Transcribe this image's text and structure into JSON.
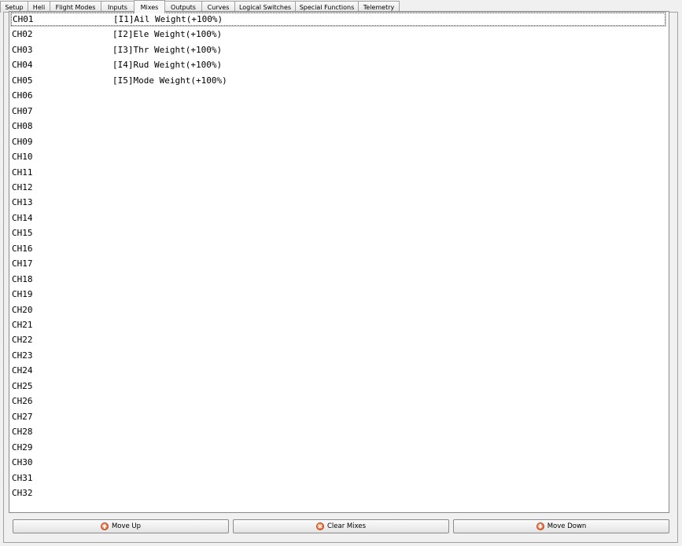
{
  "tabs": [
    {
      "label": "Setup",
      "active": false
    },
    {
      "label": "Heli",
      "active": false
    },
    {
      "label": "Flight Modes",
      "active": false
    },
    {
      "label": "Inputs",
      "active": false
    },
    {
      "label": "Mixes",
      "active": true
    },
    {
      "label": "Outputs",
      "active": false
    },
    {
      "label": "Curves",
      "active": false
    },
    {
      "label": "Logical Switches",
      "active": false
    },
    {
      "label": "Special Functions",
      "active": false
    },
    {
      "label": "Telemetry",
      "active": false
    }
  ],
  "mixes": [
    {
      "channel": "CH01",
      "mix": "[I1]Ail Weight(+100%)"
    },
    {
      "channel": "CH02",
      "mix": "[I2]Ele Weight(+100%)"
    },
    {
      "channel": "CH03",
      "mix": "[I3]Thr Weight(+100%)"
    },
    {
      "channel": "CH04",
      "mix": "[I4]Rud Weight(+100%)"
    },
    {
      "channel": "CH05",
      "mix": "[I5]Mode Weight(+100%)"
    },
    {
      "channel": "CH06",
      "mix": ""
    },
    {
      "channel": "CH07",
      "mix": ""
    },
    {
      "channel": "CH08",
      "mix": ""
    },
    {
      "channel": "CH09",
      "mix": ""
    },
    {
      "channel": "CH10",
      "mix": ""
    },
    {
      "channel": "CH11",
      "mix": ""
    },
    {
      "channel": "CH12",
      "mix": ""
    },
    {
      "channel": "CH13",
      "mix": ""
    },
    {
      "channel": "CH14",
      "mix": ""
    },
    {
      "channel": "CH15",
      "mix": ""
    },
    {
      "channel": "CH16",
      "mix": ""
    },
    {
      "channel": "CH17",
      "mix": ""
    },
    {
      "channel": "CH18",
      "mix": ""
    },
    {
      "channel": "CH19",
      "mix": ""
    },
    {
      "channel": "CH20",
      "mix": ""
    },
    {
      "channel": "CH21",
      "mix": ""
    },
    {
      "channel": "CH22",
      "mix": ""
    },
    {
      "channel": "CH23",
      "mix": ""
    },
    {
      "channel": "CH24",
      "mix": ""
    },
    {
      "channel": "CH25",
      "mix": ""
    },
    {
      "channel": "CH26",
      "mix": ""
    },
    {
      "channel": "CH27",
      "mix": ""
    },
    {
      "channel": "CH28",
      "mix": ""
    },
    {
      "channel": "CH29",
      "mix": ""
    },
    {
      "channel": "CH30",
      "mix": ""
    },
    {
      "channel": "CH31",
      "mix": ""
    },
    {
      "channel": "CH32",
      "mix": ""
    }
  ],
  "buttons": {
    "move_up": {
      "label": "Move Up",
      "icon": "arrow-up-icon"
    },
    "clear": {
      "label": "Clear Mixes",
      "icon": "clear-icon"
    },
    "move_down": {
      "label": "Move Down",
      "icon": "arrow-down-icon"
    }
  },
  "colors": {
    "icon": "#e2541c"
  }
}
